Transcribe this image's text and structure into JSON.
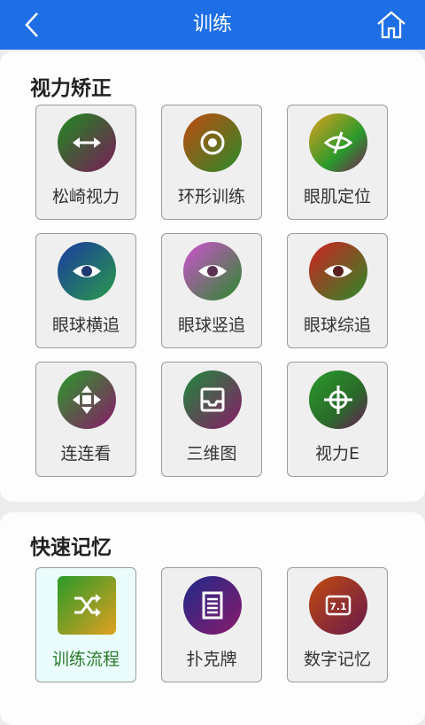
{
  "header": {
    "title": "训练",
    "back_icon": "chevron-left-icon",
    "home_icon": "home-icon",
    "color": "#1e6fe6"
  },
  "sections": [
    {
      "title": "视力矫正",
      "tiles": [
        {
          "label": "松崎视力",
          "icon": "double-arrow-icon"
        },
        {
          "label": "环形训练",
          "icon": "target-ring-icon"
        },
        {
          "label": "眼肌定位",
          "icon": "eye-slash-icon"
        },
        {
          "label": "眼球横追",
          "icon": "eye-icon"
        },
        {
          "label": "眼球竖追",
          "icon": "eye-icon"
        },
        {
          "label": "眼球综追",
          "icon": "eye-icon"
        },
        {
          "label": "连连看",
          "icon": "move-arrows-icon"
        },
        {
          "label": "三维图",
          "icon": "inbox-tray-icon"
        },
        {
          "label": "视力E",
          "icon": "crosshair-icon"
        }
      ]
    },
    {
      "title": "快速记忆",
      "tiles": [
        {
          "label": "训练流程",
          "icon": "shuffle-icon",
          "selected": true
        },
        {
          "label": "扑克牌",
          "icon": "list-document-icon"
        },
        {
          "label": "数字记忆",
          "icon": "number-card-icon"
        }
      ]
    }
  ]
}
